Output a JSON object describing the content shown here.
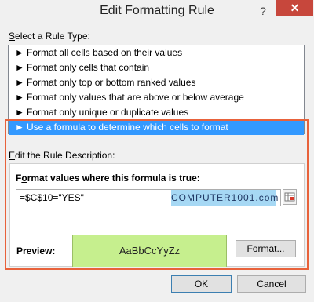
{
  "window": {
    "title": "Edit Formatting Rule",
    "help_glyph": "?",
    "close_glyph": "✕"
  },
  "rule_type": {
    "label_prefix": "S",
    "label_rest": "elect a Rule Type:",
    "arrow": "►",
    "items": [
      "Format all cells based on their values",
      "Format only cells that contain",
      "Format only top or bottom ranked values",
      "Format only values that are above or below average",
      "Format only unique or duplicate values",
      "Use a formula to determine which cells to format"
    ],
    "selected_index": 5
  },
  "description": {
    "label_prefix": "E",
    "label_rest": "dit the Rule Description:",
    "formula_label_a": "F",
    "formula_label_b": "o",
    "formula_label_c": "rmat values where this formula is true:",
    "formula_value": "=$C$10=\"YES\"",
    "watermark": "COMPUTER1001.com"
  },
  "preview": {
    "label": "Preview:",
    "sample": "AaBbCcYyZz",
    "sample_color": "#c6ef8e",
    "format_button_prefix": "F",
    "format_button_rest": "ormat..."
  },
  "buttons": {
    "ok": "OK",
    "cancel": "Cancel"
  },
  "colors": {
    "selection": "#3399ff",
    "highlight_border": "#e8623b",
    "close": "#c7473c"
  }
}
